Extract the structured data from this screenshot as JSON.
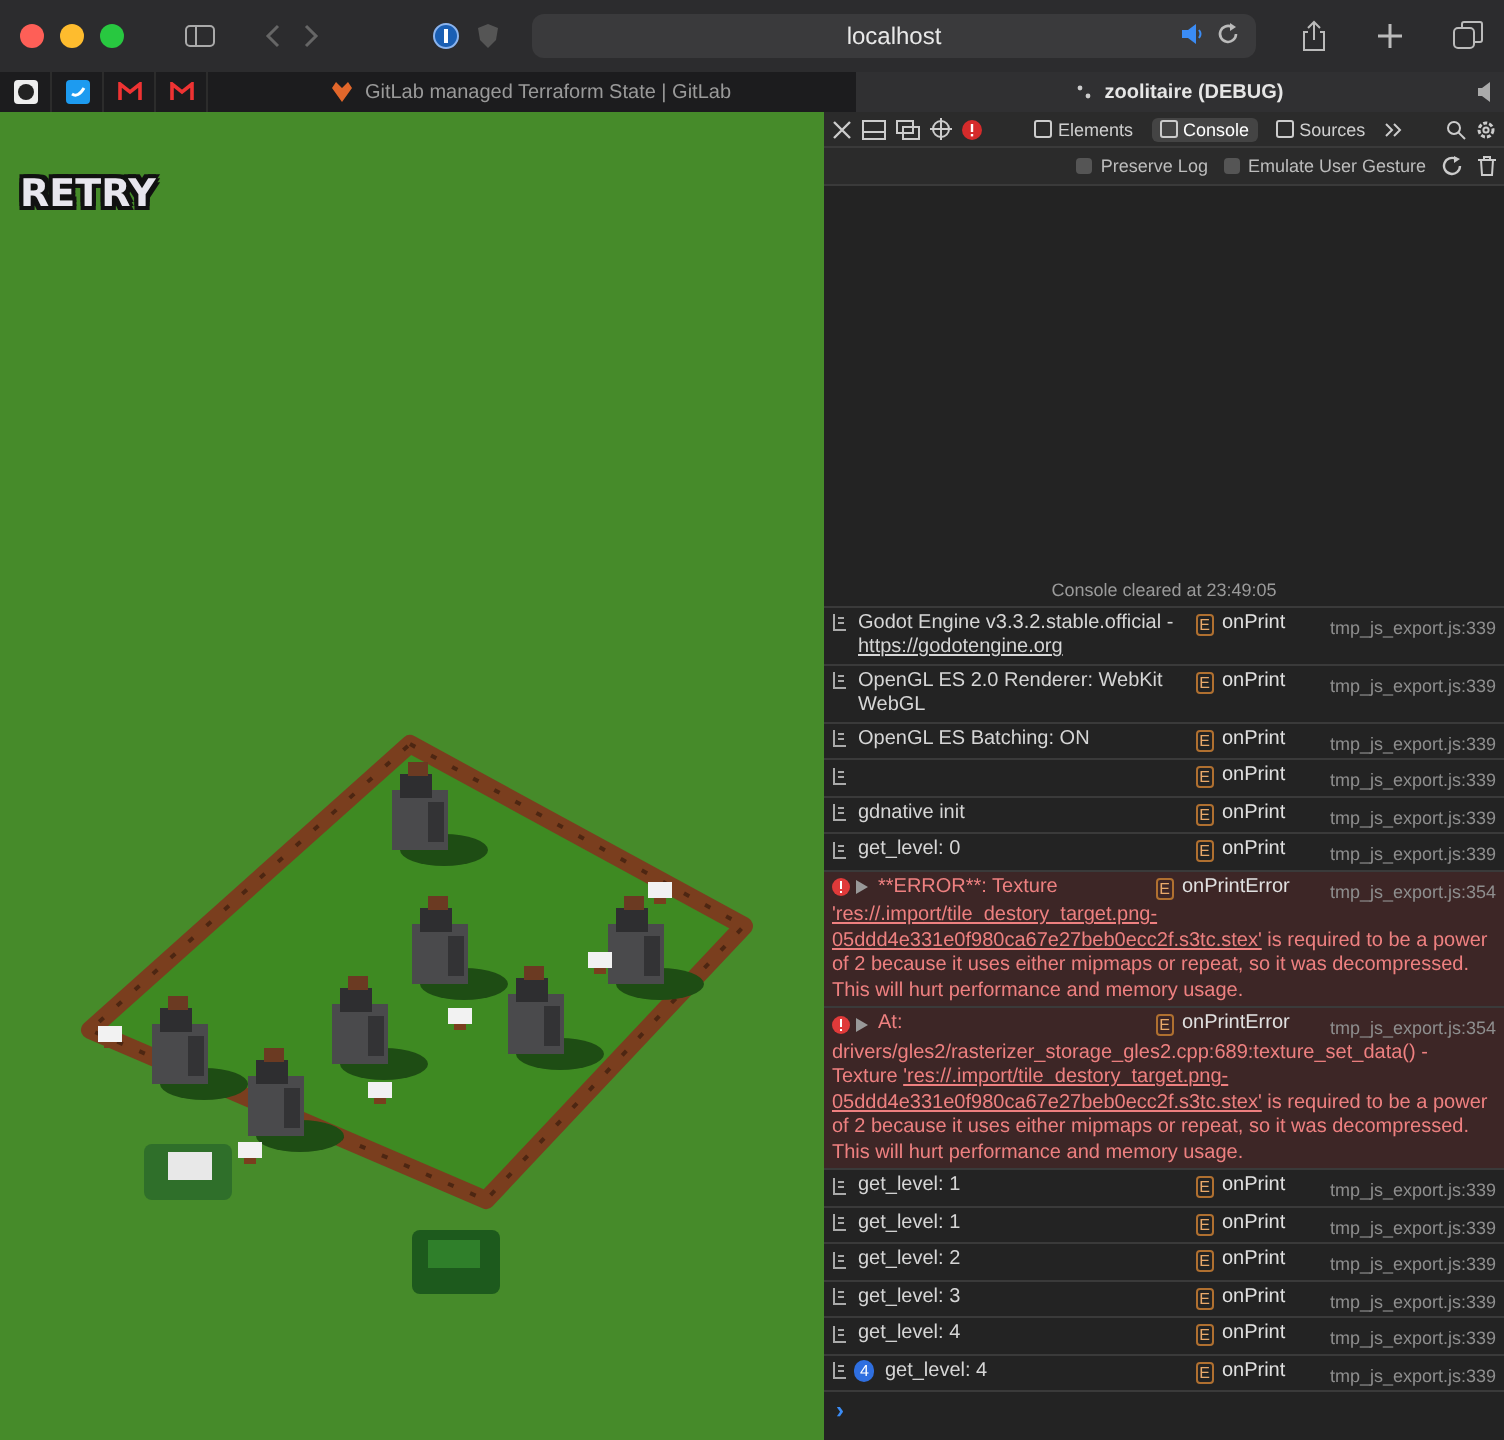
{
  "browser": {
    "address": "localhost",
    "tabs": [
      {
        "title": "GitLab managed Terraform State | GitLab",
        "selected": false
      },
      {
        "title": "zoolitaire (DEBUG)",
        "selected": true
      }
    ]
  },
  "game": {
    "button": "RETRY"
  },
  "devtools": {
    "tabs": [
      {
        "label": "Elements",
        "selected": false
      },
      {
        "label": "Console",
        "selected": true
      },
      {
        "label": "Sources",
        "selected": false
      }
    ],
    "options": [
      {
        "label": "Preserve Log",
        "checked": false
      },
      {
        "label": "Emulate User Gesture",
        "checked": false
      }
    ],
    "cleared": "Console cleared at 23:49:05",
    "messages": [
      {
        "kind": "log",
        "parts": [
          {
            "kind": "text",
            "text": "Godot Engine v3.3.2.stable.official - "
          },
          {
            "kind": "link",
            "text": "https://godotengine.org"
          }
        ],
        "badge": "E",
        "func": "onPrint",
        "source": "tmp_js_export.js:339"
      },
      {
        "kind": "log",
        "parts": [
          {
            "kind": "text",
            "text": "OpenGL ES 2.0 Renderer: WebKit WebGL"
          }
        ],
        "badge": "E",
        "func": "onPrint",
        "source": "tmp_js_export.js:339"
      },
      {
        "kind": "log",
        "parts": [
          {
            "kind": "text",
            "text": "OpenGL ES Batching: ON"
          }
        ],
        "badge": "E",
        "func": "onPrint",
        "source": "tmp_js_export.js:339"
      },
      {
        "kind": "log",
        "badge": "E",
        "func": "onPrint",
        "source": "tmp_js_export.js:339"
      },
      {
        "kind": "log",
        "parts": [
          {
            "kind": "text",
            "text": "gdnative init"
          }
        ],
        "badge": "E",
        "func": "onPrint",
        "source": "tmp_js_export.js:339"
      },
      {
        "kind": "log",
        "parts": [
          {
            "kind": "text",
            "text": "get_level: 0"
          }
        ],
        "badge": "E",
        "func": "onPrint",
        "source": "tmp_js_export.js:339"
      },
      {
        "kind": "error",
        "summary": "**ERROR**: Texture",
        "parts": [
          {
            "kind": "link",
            "text": "'res://.import/tile_destory_target.png-"
          },
          {
            "kind": "link",
            "text": "05ddd4e331e0f980ca67e27beb0ecc2f.s3tc.stex'"
          },
          {
            "kind": "text",
            "text": " is required to be a power of 2 because it uses either mipmaps or repeat, so it was decompressed. This will hurt performance and memory usage."
          }
        ],
        "badge": "E",
        "func": "onPrintError",
        "source": "tmp_js_export.js:354"
      },
      {
        "kind": "error",
        "summary": "At:",
        "parts": [
          {
            "kind": "text",
            "text": "drivers/gles2/rasterizer_storage_gles2.cpp:689:texture_set_data() - Texture "
          },
          {
            "kind": "link",
            "text": "'res://.import/tile_destory_target.png-"
          },
          {
            "kind": "link",
            "text": "05ddd4e331e0f980ca67e27beb0ecc2f.s3tc.stex'"
          },
          {
            "kind": "text",
            "text": " is required to be a power of 2 because it uses either mipmaps or repeat, so it was decompressed. This will hurt performance and memory usage."
          }
        ],
        "badge": "E",
        "func": "onPrintError",
        "source": "tmp_js_export.js:354"
      },
      {
        "kind": "log",
        "parts": [
          {
            "kind": "text",
            "text": "get_level: 1"
          }
        ],
        "badge": "E",
        "func": "onPrint",
        "source": "tmp_js_export.js:339"
      },
      {
        "kind": "log",
        "parts": [
          {
            "kind": "text",
            "text": "get_level: 1"
          }
        ],
        "badge": "E",
        "func": "onPrint",
        "source": "tmp_js_export.js:339"
      },
      {
        "kind": "log",
        "parts": [
          {
            "kind": "text",
            "text": "get_level: 2"
          }
        ],
        "badge": "E",
        "func": "onPrint",
        "source": "tmp_js_export.js:339"
      },
      {
        "kind": "log",
        "parts": [
          {
            "kind": "text",
            "text": "get_level: 3"
          }
        ],
        "badge": "E",
        "func": "onPrint",
        "source": "tmp_js_export.js:339"
      },
      {
        "kind": "log",
        "parts": [
          {
            "kind": "text",
            "text": "get_level: 4"
          }
        ],
        "badge": "E",
        "func": "onPrint",
        "source": "tmp_js_export.js:339"
      },
      {
        "kind": "log",
        "count": "4",
        "parts": [
          {
            "kind": "text",
            "text": "get_level: 4"
          }
        ],
        "badge": "E",
        "func": "onPrint",
        "source": "tmp_js_export.js:339"
      }
    ],
    "prompt": "›"
  }
}
